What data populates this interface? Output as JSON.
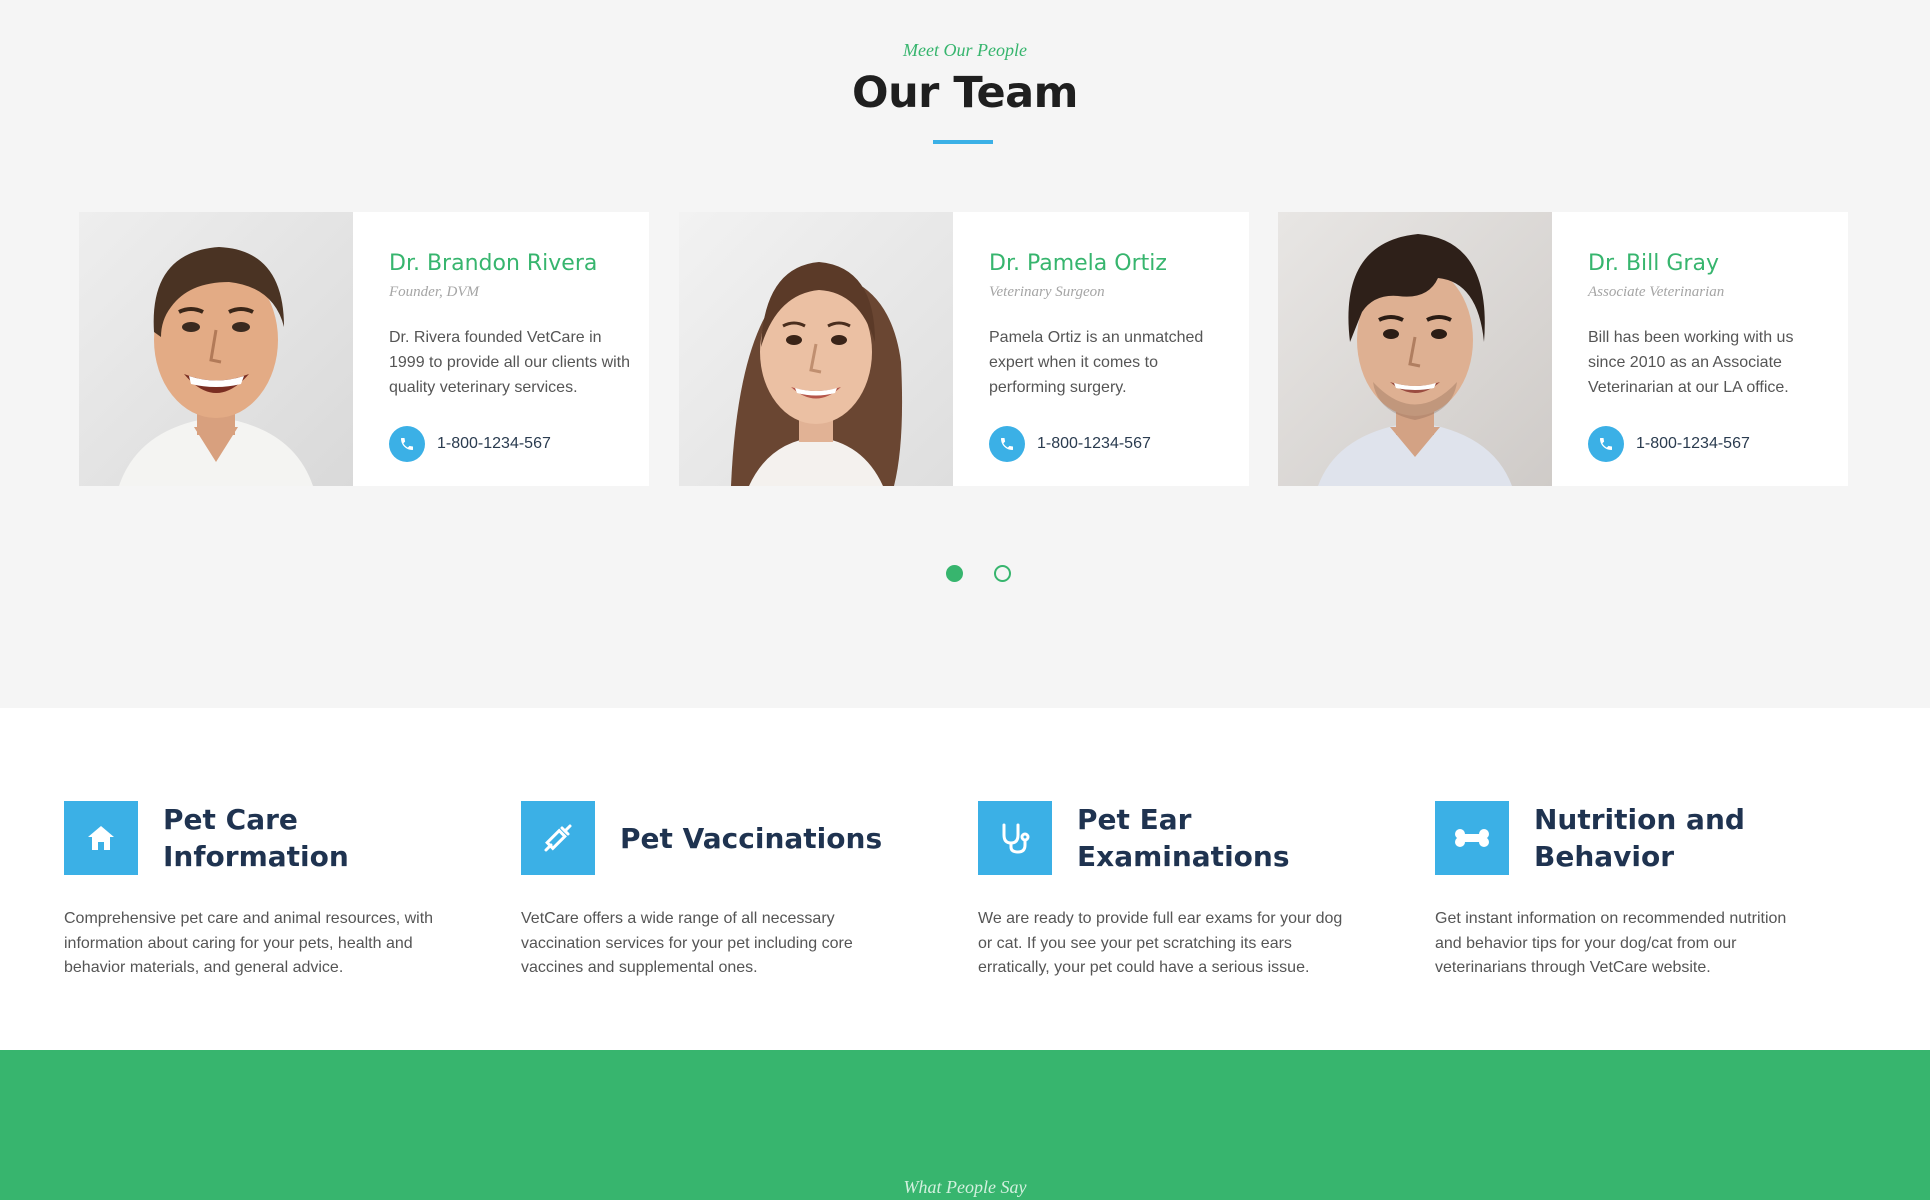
{
  "team": {
    "eyebrow": "Meet Our People",
    "title": "Our Team",
    "members": [
      {
        "name": "Dr. Brandon Rivera",
        "role": "Founder, DVM",
        "bio": "Dr. Rivera founded VetCare in 1999 to provide all our clients with quality veterinary services.",
        "phone": "1-800-1234-567"
      },
      {
        "name": "Dr. Pamela Ortiz",
        "role": "Veterinary Surgeon",
        "bio": "Pamela Ortiz is an unmatched expert when it comes to performing surgery.",
        "phone": "1-800-1234-567"
      },
      {
        "name": "Dr. Bill Gray",
        "role": "Associate Veterinarian",
        "bio": "Bill has been working with us since 2010 as an Associate Veterinarian at our LA office.",
        "phone": "1-800-1234-567"
      }
    ],
    "pagination": {
      "pages": 2,
      "active": 1
    }
  },
  "services": [
    {
      "icon": "house-icon",
      "title": "Pet Care Information",
      "description": "Comprehensive pet care and animal resources, with information about caring for your pets, health and behavior materials, and general advice."
    },
    {
      "icon": "syringe-icon",
      "title": "Pet Vaccinations",
      "description": "VetCare offers a wide range of all necessary vaccination services for your pet including core vaccines and supplemental ones."
    },
    {
      "icon": "stethoscope-icon",
      "title": "Pet Ear Examinations",
      "description": "We are ready to provide full ear exams for your dog or cat. If you see your pet scratching its ears erratically, your pet could have a serious issue."
    },
    {
      "icon": "bone-icon",
      "title": "Nutrition and Behavior",
      "description": "Get instant information on recommended nutrition and behavior tips for your dog/cat from our veterinarians through VetCare website."
    }
  ],
  "testimonials": {
    "eyebrow": "What People Say"
  },
  "colors": {
    "accent_green": "#37b56e",
    "accent_blue": "#3bb0e6",
    "heading_dark": "#1f3350"
  }
}
